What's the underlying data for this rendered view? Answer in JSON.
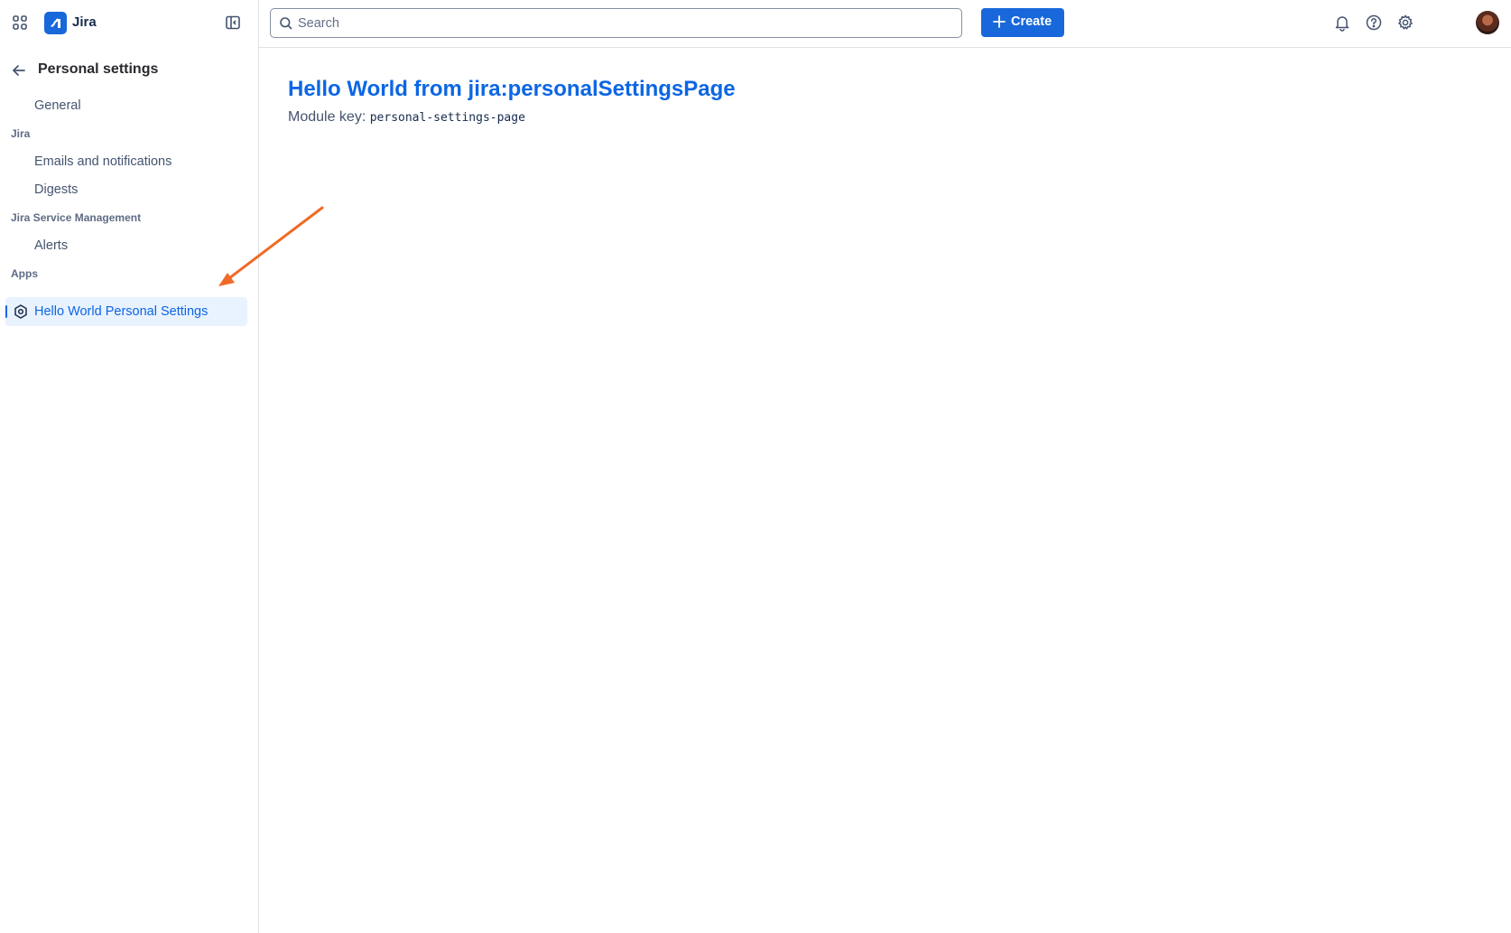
{
  "app": {
    "name": "Jira",
    "brand_color": "#1868db"
  },
  "sidebar": {
    "back_title": "Personal settings",
    "general_label": "General",
    "sections": [
      {
        "title": "Jira",
        "items": [
          "Emails and notifications",
          "Digests"
        ]
      },
      {
        "title": "Jira Service Management",
        "items": [
          "Alerts"
        ]
      },
      {
        "title": "Apps",
        "items": [
          "Hello World Personal Settings"
        ]
      }
    ],
    "active_item": "Hello World Personal Settings",
    "active_color": "#0c66e4"
  },
  "topbar": {
    "search_placeholder": "Search",
    "create_label": "Create",
    "icons": [
      "bell-icon",
      "help-icon",
      "settings-gear-icon",
      "avatar"
    ]
  },
  "main": {
    "heading": "Hello World from jira:personalSettingsPage",
    "module_key_label": "Module key:",
    "module_key_value": "personal-settings-page"
  },
  "annotation": {
    "type": "arrow",
    "color": "#f06a26"
  }
}
